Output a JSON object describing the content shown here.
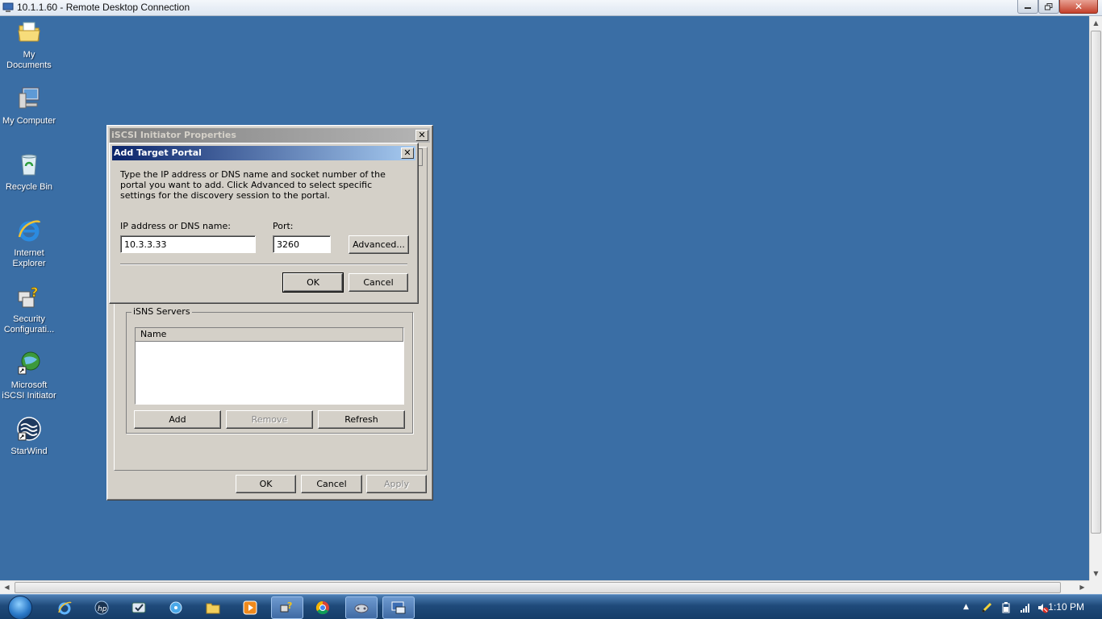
{
  "rdp": {
    "title": "10.1.1.60 - Remote Desktop Connection"
  },
  "desktop": {
    "icons": [
      {
        "label": "My Documents",
        "icon": "folder-documents-icon"
      },
      {
        "label": "My Computer",
        "icon": "computer-icon"
      },
      {
        "label": "Recycle Bin",
        "icon": "recycle-bin-icon"
      },
      {
        "label": "Internet Explorer",
        "icon": "internet-explorer-icon"
      },
      {
        "label": "Security Configurati...",
        "icon": "security-config-icon"
      },
      {
        "label": "Microsoft iSCSI Initiator",
        "icon": "iscsi-initiator-icon"
      },
      {
        "label": "StarWind",
        "icon": "starwind-icon"
      }
    ]
  },
  "iscsi_window": {
    "title": "iSCSI Initiator Properties",
    "isns": {
      "group_title": "iSNS Servers",
      "column_name": "Name",
      "add_label": "Add",
      "remove_label": "Remove",
      "refresh_label": "Refresh"
    },
    "ok_label": "OK",
    "cancel_label": "Cancel",
    "apply_label": "Apply"
  },
  "add_portal_dialog": {
    "title": "Add Target Portal",
    "description": "Type the IP address or DNS name and socket number of the portal you want to add. Click Advanced to select specific settings for the discovery session to the portal.",
    "ip_label": "IP address or DNS name:",
    "ip_value": "10.3.3.33",
    "port_label": "Port:",
    "port_value": "3260",
    "advanced_label": "Advanced...",
    "ok_label": "OK",
    "cancel_label": "Cancel"
  },
  "taskbar": {
    "clock": "1:10 PM",
    "items": [
      "internet-explorer-icon",
      "hp-icon",
      "email-icon",
      "media-icon",
      "explorer-folder-icon",
      "media-player-icon",
      "remote-settings-icon",
      "chrome-icon",
      "game-controller-icon",
      "remote-desktop-icon"
    ]
  },
  "colors": {
    "desktop": "#3a6ea5",
    "active_title": "#0a246a",
    "inactive_title": "#808080"
  }
}
